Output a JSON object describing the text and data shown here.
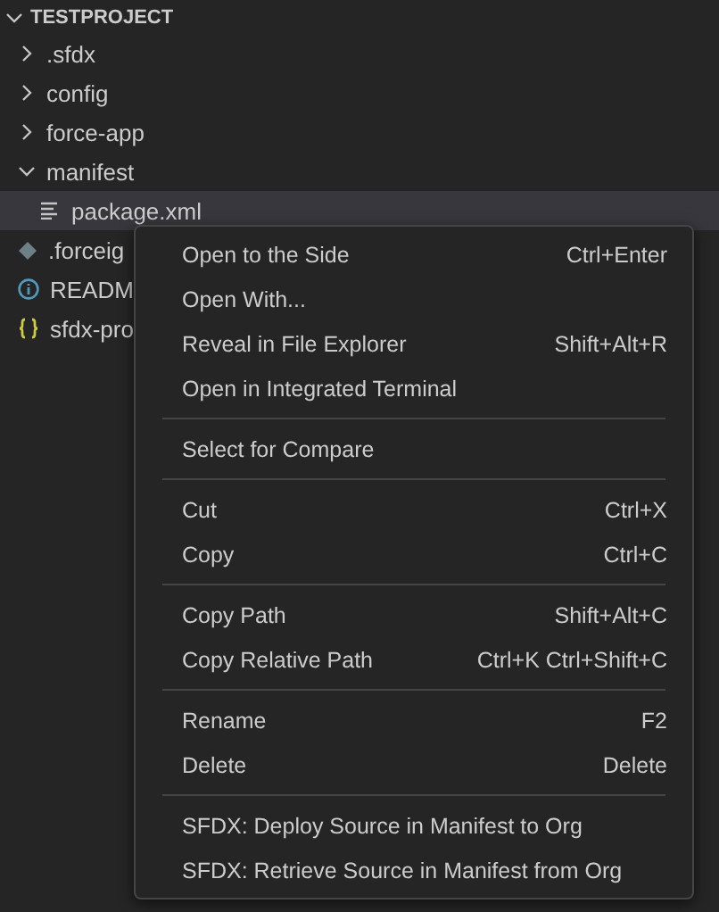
{
  "explorer": {
    "title": "TESTPROJECT",
    "expanded": true,
    "items": [
      {
        "label": ".sfdx",
        "kind": "folder",
        "expanded": false,
        "selected": false
      },
      {
        "label": "config",
        "kind": "folder",
        "expanded": false,
        "selected": false
      },
      {
        "label": "force-app",
        "kind": "folder",
        "expanded": false,
        "selected": false
      },
      {
        "label": "manifest",
        "kind": "folder",
        "expanded": true,
        "selected": false,
        "children": [
          {
            "label": "package.xml",
            "kind": "lines",
            "selected": true
          }
        ]
      },
      {
        "label": ".forceig",
        "kind": "diamond",
        "selected": false
      },
      {
        "label": "READM",
        "kind": "info",
        "selected": false
      },
      {
        "label": "sfdx-pro",
        "kind": "braces",
        "selected": false
      }
    ]
  },
  "context_menu": {
    "groups": [
      [
        {
          "label": "Open to the Side",
          "shortcut": "Ctrl+Enter"
        },
        {
          "label": "Open With..."
        },
        {
          "label": "Reveal in File Explorer",
          "shortcut": "Shift+Alt+R"
        },
        {
          "label": "Open in Integrated Terminal"
        }
      ],
      [
        {
          "label": "Select for Compare"
        }
      ],
      [
        {
          "label": "Cut",
          "shortcut": "Ctrl+X"
        },
        {
          "label": "Copy",
          "shortcut": "Ctrl+C"
        }
      ],
      [
        {
          "label": "Copy Path",
          "shortcut": "Shift+Alt+C"
        },
        {
          "label": "Copy Relative Path",
          "shortcut": "Ctrl+K Ctrl+Shift+C"
        }
      ],
      [
        {
          "label": "Rename",
          "shortcut": "F2"
        },
        {
          "label": "Delete",
          "shortcut": "Delete"
        }
      ],
      [
        {
          "label": "SFDX: Deploy Source in Manifest to Org"
        },
        {
          "label": "SFDX: Retrieve Source in Manifest from Org"
        }
      ]
    ]
  }
}
